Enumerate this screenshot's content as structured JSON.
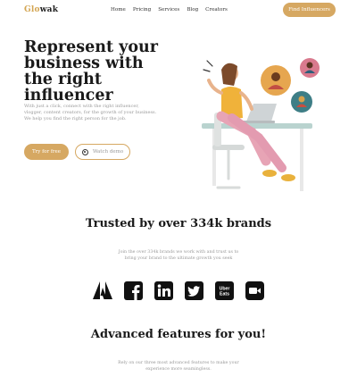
{
  "nav": {
    "logo_part1": "Glo",
    "logo_part2": "wak",
    "items": [
      "Home",
      "Pricing",
      "Services",
      "Blog",
      "Creators"
    ],
    "cta": "Find Influencers"
  },
  "hero": {
    "title": "Represent your business with the right influencer",
    "subtitle": "With just a click, connect with the right influencer, vlogger, content creators, for the growth of your business. We help you find the right person for the job.",
    "primary_button": "Try for free",
    "secondary_button": "Watch demo"
  },
  "trusted": {
    "title": "Trusted by over 334k brands",
    "subtitle": "Join the over 334k brands we work with and trust us to bring your brand to the ultimate growth you seek"
  },
  "brands": [
    {
      "icon": "adobe-icon"
    },
    {
      "icon": "facebook-icon"
    },
    {
      "icon": "linkedin-icon"
    },
    {
      "icon": "twitter-icon"
    },
    {
      "icon": "uber-eats-icon",
      "label_line1": "Uber",
      "label_line2": "Eats"
    },
    {
      "icon": "video-camera-icon"
    }
  ],
  "features": {
    "title": "Advanced features for you!",
    "subtitle": "Rely on our three most advanced features to make your experience more seamingless."
  },
  "colors": {
    "accent": "#d6a862",
    "heading": "#1a1a1a",
    "muted": "#9a9a9a"
  }
}
